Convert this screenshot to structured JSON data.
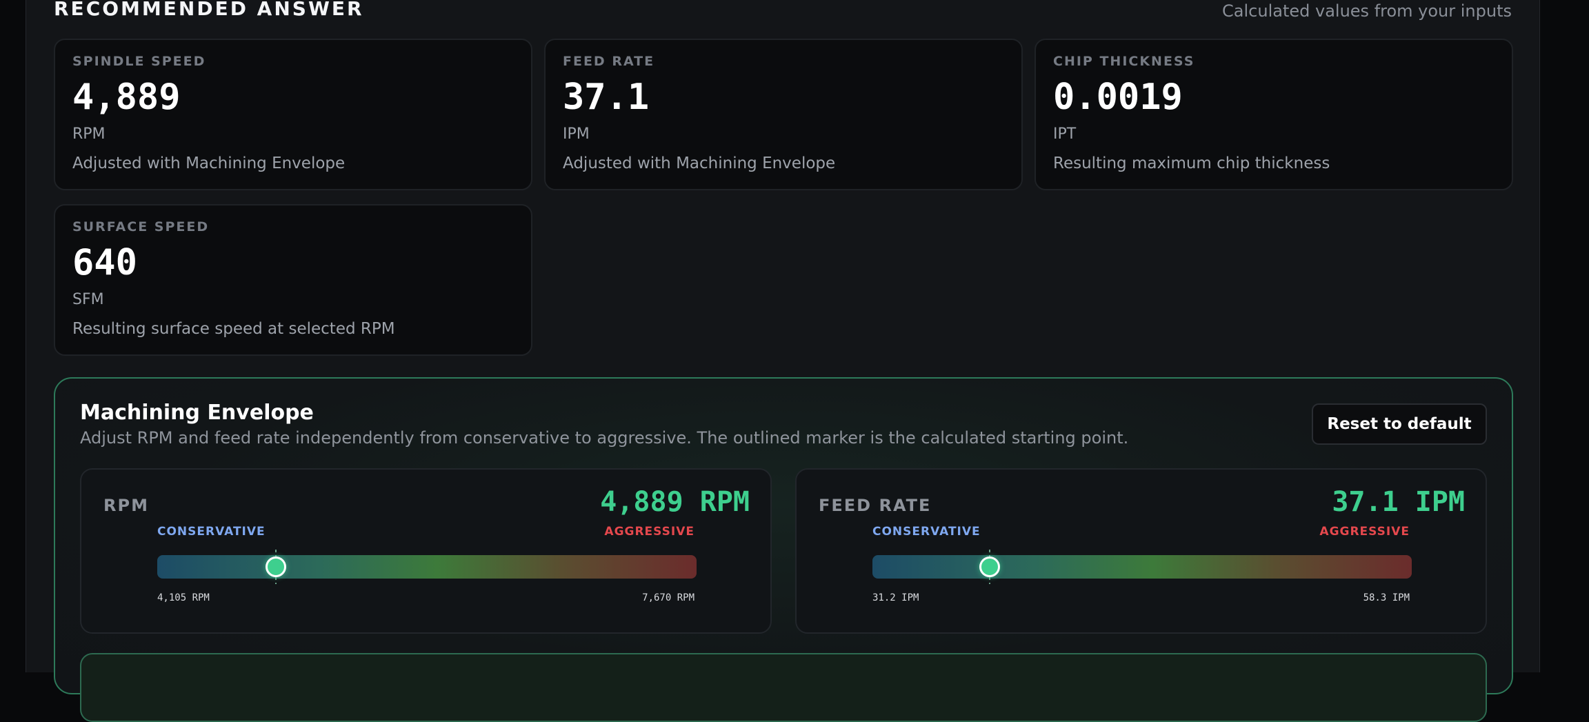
{
  "header": {
    "title": "RECOMMENDED ANSWER",
    "subtitle": "Calculated values from your inputs"
  },
  "cards": [
    {
      "label": "SPINDLE SPEED",
      "value": "4,889",
      "unit": "RPM",
      "note": "Adjusted with Machining Envelope"
    },
    {
      "label": "FEED RATE",
      "value": "37.1",
      "unit": "IPM",
      "note": "Adjusted with Machining Envelope"
    },
    {
      "label": "CHIP THICKNESS",
      "value": "0.0019",
      "unit": "IPT",
      "note": "Resulting maximum chip thickness"
    },
    {
      "label": "SURFACE SPEED",
      "value": "640",
      "unit": "SFM",
      "note": "Resulting surface speed at selected RPM"
    }
  ],
  "envelope": {
    "title": "Machining Envelope",
    "description": "Adjust RPM and feed rate independently from conservative to aggressive. The outlined marker is the calculated starting point.",
    "reset_label": "Reset to default",
    "sliders": [
      {
        "label": "RPM",
        "value_text": "4,889 RPM",
        "conservative_label": "CONSERVATIVE",
        "aggressive_label": "AGGRESSIVE",
        "min_text": "4,105 RPM",
        "max_text": "7,670 RPM",
        "min": 4105,
        "max": 7670,
        "value": 4889,
        "default": 4889
      },
      {
        "label": "FEED RATE",
        "value_text": "37.1 IPM",
        "conservative_label": "CONSERVATIVE",
        "aggressive_label": "AGGRESSIVE",
        "min_text": "31.2 IPM",
        "max_text": "58.3 IPM",
        "min": 31.2,
        "max": 58.3,
        "value": 37.1,
        "default": 37.1
      }
    ]
  },
  "colors": {
    "accent": "#3ecf8e",
    "conservative": "#7fa8f0",
    "aggressive": "#e5484d"
  }
}
